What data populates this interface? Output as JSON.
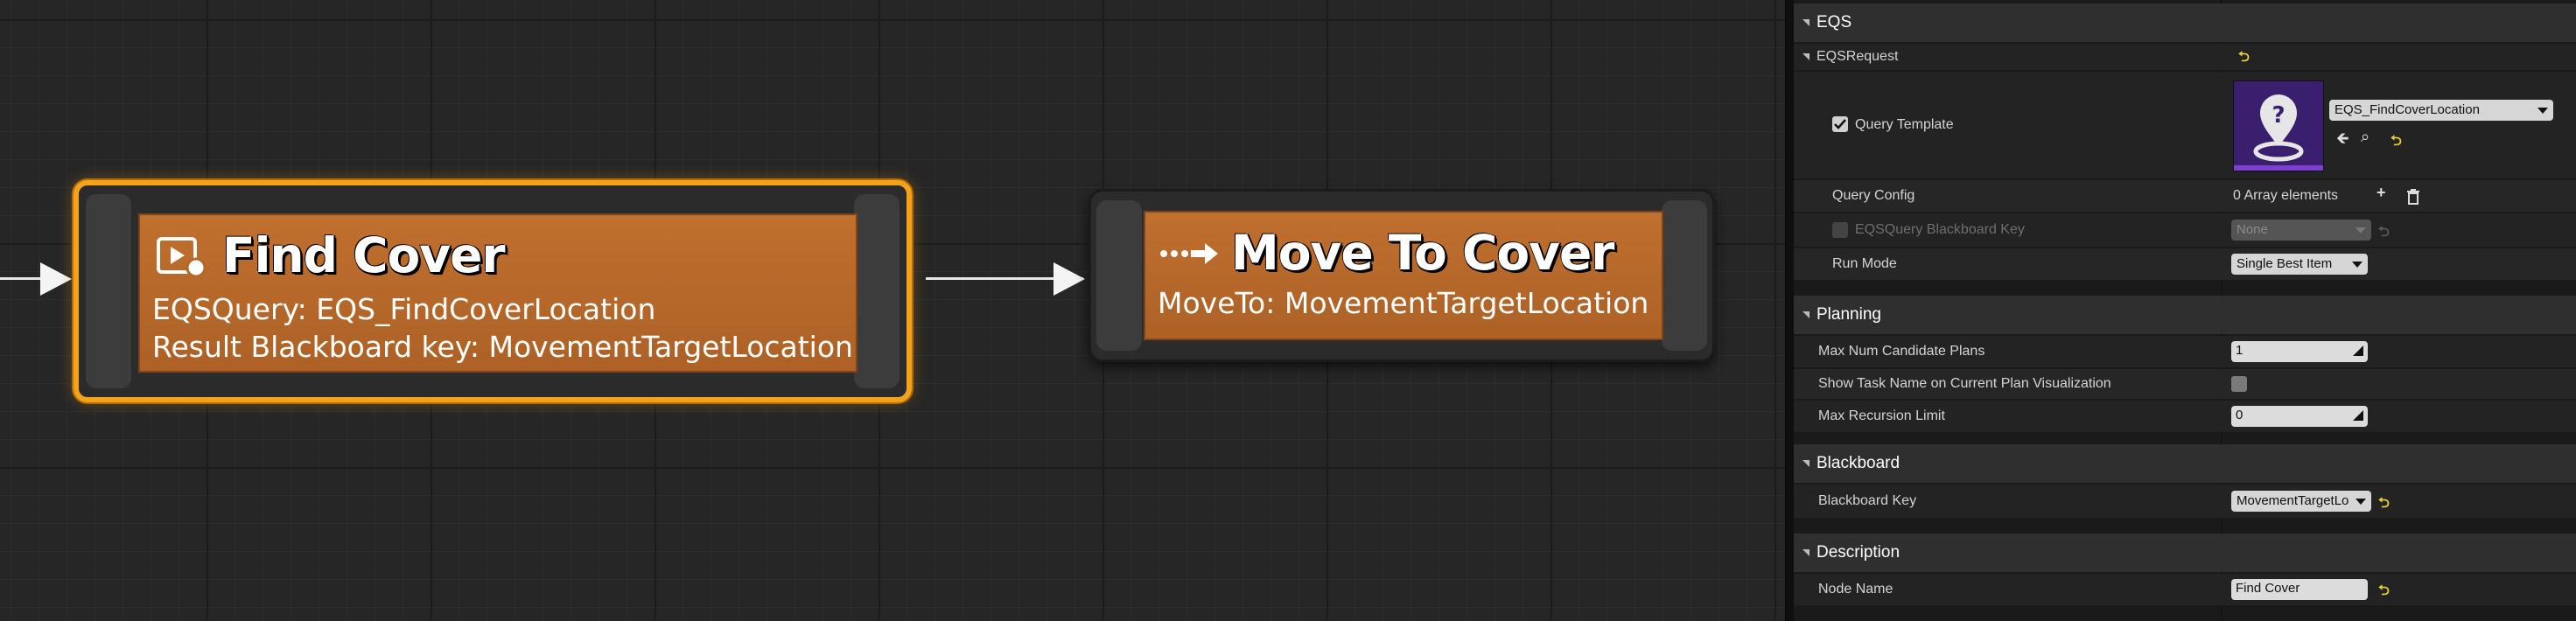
{
  "graph": {
    "find_cover": {
      "title": "Find Cover",
      "desc_line1": "EQSQuery: EQS_FindCoverLocation",
      "desc_line2": "Result Blackboard key: MovementTargetLocation"
    },
    "move_to_cover": {
      "title": "Move To Cover",
      "desc_line1": "MoveTo: MovementTargetLocation"
    }
  },
  "details": {
    "eqs": {
      "header": "EQS",
      "request_label": "EQSRequest",
      "query_template_label": "Query Template",
      "query_template_value": "EQS_FindCoverLocation",
      "query_config_label": "Query Config",
      "query_config_value": "0 Array elements",
      "bb_key_label": "EQSQuery Blackboard Key",
      "bb_key_value": "None",
      "run_mode_label": "Run Mode",
      "run_mode_value": "Single Best Item"
    },
    "planning": {
      "header": "Planning",
      "max_candidates_label": "Max Num Candidate Plans",
      "max_candidates_value": "1",
      "show_task_name_label": "Show Task Name on Current Plan Visualization",
      "max_recursion_label": "Max Recursion Limit",
      "max_recursion_value": "0"
    },
    "blackboard": {
      "header": "Blackboard",
      "key_label": "Blackboard Key",
      "key_value": "MovementTargetLo"
    },
    "description": {
      "header": "Description",
      "node_name_label": "Node Name",
      "node_name_value": "Find Cover"
    }
  },
  "colors": {
    "node_body": "#b5662a",
    "selection_outline": "#f3a21a",
    "reset_arrow": "#e7d13b"
  }
}
